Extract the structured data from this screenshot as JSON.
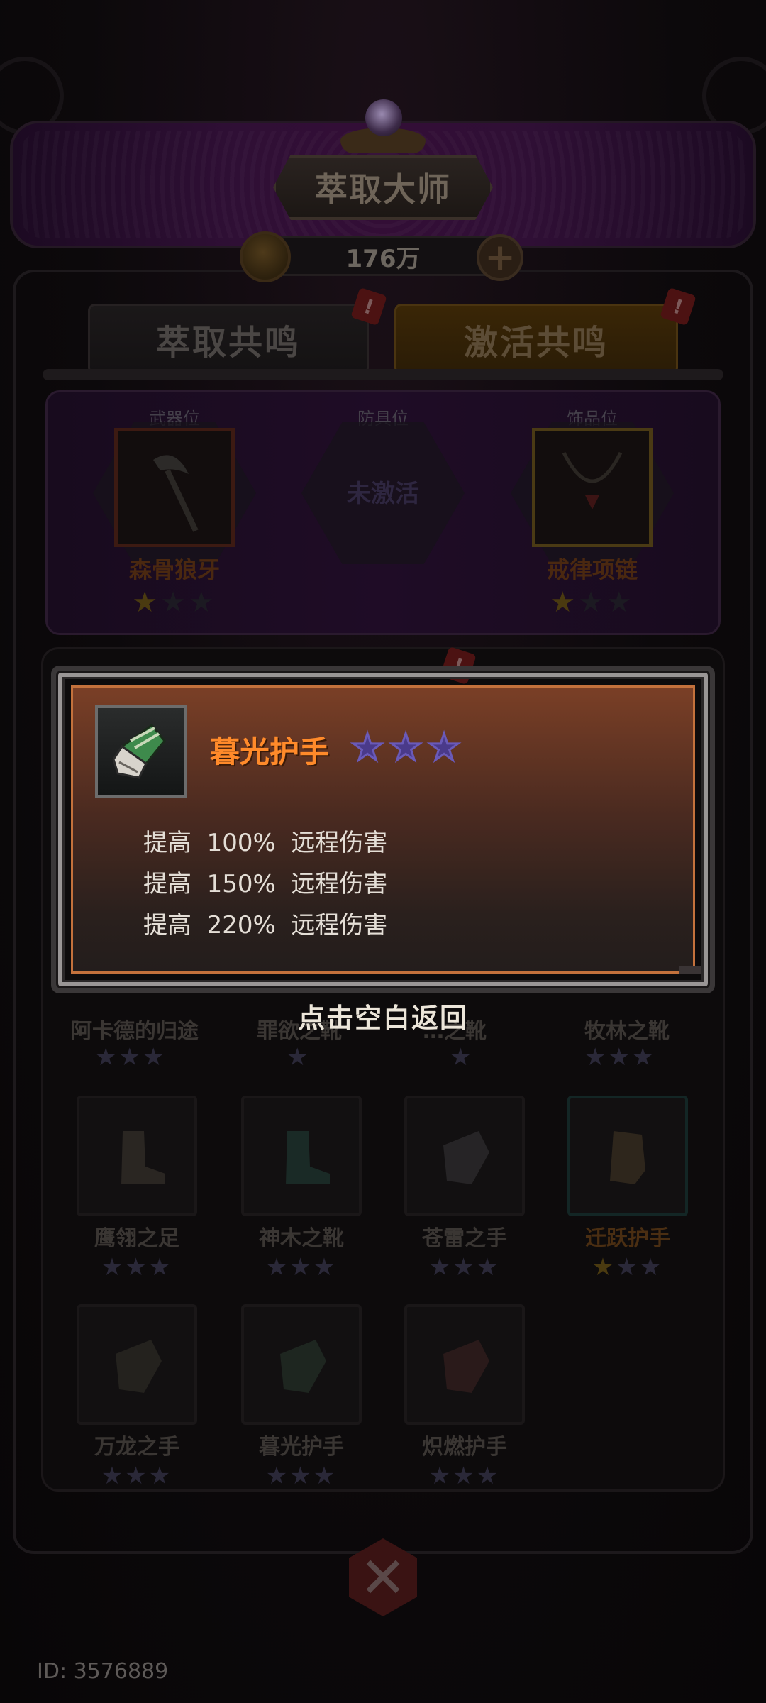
{
  "header": {
    "title": "萃取大师",
    "currency_value": "176万"
  },
  "tabs": [
    {
      "label": "萃取共鸣",
      "badge": "!"
    },
    {
      "label": "激活共鸣",
      "badge": "!"
    }
  ],
  "slots": [
    {
      "position_label": "武器位",
      "item_name": "森骨狼牙",
      "stars_filled": 1,
      "stars_total": 3
    },
    {
      "position_label": "防具位",
      "status": "未激活"
    },
    {
      "position_label": "饰品位",
      "item_name": "戒律项链",
      "stars_filled": 1,
      "stars_total": 3
    }
  ],
  "list_badge": "!",
  "grid_row1_occluded": [
    "阿卡德的归途",
    "罪欲之靴",
    "…之靴",
    "牧林之靴"
  ],
  "grid_items": [
    {
      "name": "鹰翎之足",
      "stars_filled": 0
    },
    {
      "name": "神木之靴",
      "stars_filled": 0
    },
    {
      "name": "苍雷之手",
      "stars_filled": 0
    },
    {
      "name": "迁跃护手",
      "stars_filled": 1
    },
    {
      "name": "万龙之手",
      "stars_filled": 0
    },
    {
      "name": "暮光护手",
      "stars_filled": 0
    },
    {
      "name": "炽燃护手",
      "stars_filled": 0
    }
  ],
  "popup": {
    "item_name": "暮光护手",
    "stars": 3,
    "stats": [
      "提高  100%  远程伤害",
      "提高  150%  远程伤害",
      "提高  220%  远程伤害"
    ]
  },
  "back_hint": "点击空白返回",
  "footer": {
    "id_text": "ID: 3576889"
  },
  "colors": {
    "popup_title": "#ff8a2a",
    "popup_border": "#c3713c",
    "star_purple": "#4a3a8a"
  }
}
